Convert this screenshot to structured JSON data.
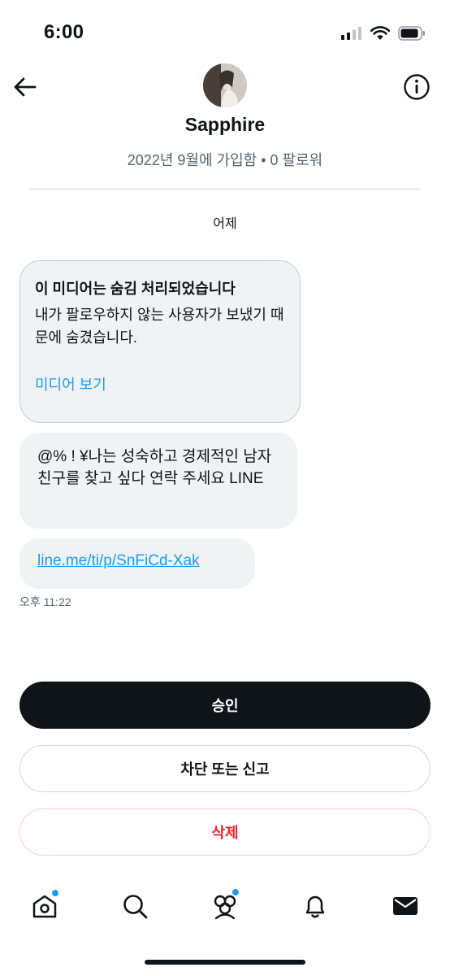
{
  "status_bar": {
    "time": "6:00"
  },
  "profile": {
    "name": "Sapphire",
    "meta": "2022년 9월에 가입함 • 0 팔로워"
  },
  "conversation": {
    "day_label": "어제",
    "hidden_media": {
      "title": "이 미디어는 숨김 처리되었습니다",
      "description": "내가 팔로우하지 않는 사용자가 보냈기 때문에 숨겼습니다.",
      "view_link": "미디어 보기"
    },
    "messages": [
      {
        "text": "@% ! ¥나는 성숙하고 경제적인 남자친구를 찾고 싶다  연락 주세요 LINE"
      },
      {
        "link": "line.me/ti/p/SnFiCd-Xak"
      }
    ],
    "timestamp": "오후 11:22"
  },
  "actions": {
    "accept": "승인",
    "block_report": "차단 또는 신고",
    "delete": "삭제"
  },
  "nav": {
    "items": [
      "home-icon",
      "search-icon",
      "communities-icon",
      "notifications-icon",
      "messages-icon"
    ]
  },
  "colors": {
    "accent": "#1d9bf0",
    "danger": "#f4212e",
    "primary_button": "#0f1419",
    "bubble": "#eff3f4"
  }
}
